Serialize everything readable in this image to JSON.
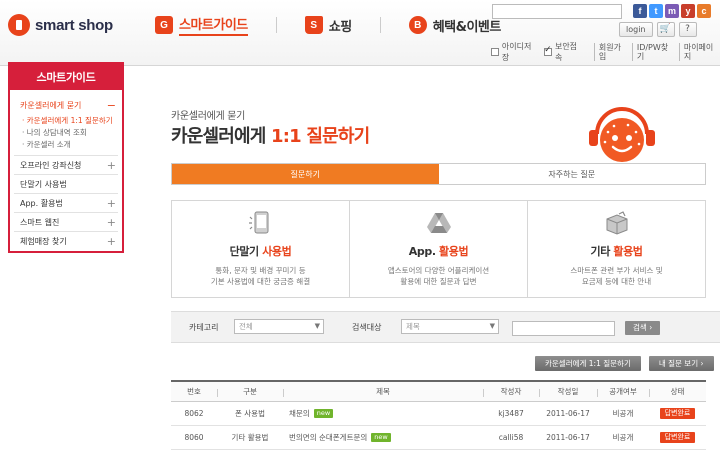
{
  "header": {
    "logo_text": "smart shop",
    "gnb": [
      {
        "label": "스마트가이드",
        "icon": "G"
      },
      {
        "label": "쇼핑",
        "icon": "S"
      },
      {
        "label": "혜택&이벤트",
        "icon": "B"
      }
    ],
    "login_label": "login",
    "help_label": "?",
    "util": {
      "save_id": "아이디저장",
      "secure": "보안접속",
      "join": "회원가입",
      "find": "ID/PW찾기",
      "mypage": "마이페이지"
    },
    "sns": [
      {
        "name": "f",
        "color": "#3b5998"
      },
      {
        "name": "t",
        "color": "#4099ff"
      },
      {
        "name": "m",
        "color": "#7b5bb5"
      },
      {
        "name": "y",
        "color": "#c83e2b"
      },
      {
        "name": "c",
        "color": "#e87b2a"
      }
    ]
  },
  "sidebar": {
    "title": "스마트가이드",
    "items": [
      {
        "label": "카운셀러에게 묻기",
        "toggle": "−"
      },
      {
        "label": "오프라인 강좌신청",
        "toggle": "+"
      },
      {
        "label": "단말기 사용법",
        "toggle": ""
      },
      {
        "label": "App. 활용법",
        "toggle": "+"
      },
      {
        "label": "스마트 웹진",
        "toggle": "+"
      },
      {
        "label": "체험매장 찾기",
        "toggle": "+"
      }
    ],
    "sub_items": [
      "카운셀러에게 1:1 질문하기",
      "나의 상담내역 조회",
      "카운셀러 소개"
    ]
  },
  "page": {
    "subtitle": "카운셀러에게 묻기",
    "title_prefix": "카운셀러에게 ",
    "title_highlight": "1:1 질문하기"
  },
  "tabs": [
    "질문하기",
    "자주하는 질문"
  ],
  "cards": [
    {
      "title_a": "단말기 ",
      "title_b": "사용법",
      "desc1": "통화, 문자 및 배경 꾸미기 등",
      "desc2": "기본 사용법에 대한 궁금증 해결"
    },
    {
      "title_a": "App. ",
      "title_b": "활용법",
      "desc1": "앱스토어의 다양한 어플리케이션",
      "desc2": "활용에 대한 질문과 답변"
    },
    {
      "title_a": "기타 ",
      "title_b": "활용법",
      "desc1": "스마트폰 관련 부가 서비스 및",
      "desc2": "요금제 등에 대한 안내"
    }
  ],
  "filter": {
    "category_label": "카테고리",
    "category_value": "전체",
    "target_label": "검색대상",
    "target_value": "제목",
    "search_button": "검색"
  },
  "actions": {
    "my_counsel": "카운셀러에게 1:1 질문하기",
    "my_question": "내 질문 보기"
  },
  "table": {
    "headers": [
      "번호",
      "구분",
      "제목",
      "작성자",
      "작성일",
      "공개여부",
      "상태"
    ],
    "rows": [
      {
        "no": "8062",
        "category": "폰 사용법",
        "title": "채문의",
        "writer": "kj3487",
        "date": "2011-06-17",
        "public": "비공개",
        "state": "답변완료"
      },
      {
        "no": "8060",
        "category": "기타 활용법",
        "title": "번의면의 순대폰게트문의",
        "writer": "calli58",
        "date": "2011-06-17",
        "public": "비공개",
        "state": "답변완료"
      }
    ],
    "new_label": "new"
  },
  "colors": {
    "accent": "#e8431b",
    "sidebar_border": "#d61f3b",
    "tab_active": "#f07b22",
    "new_badge": "#70b42c"
  }
}
